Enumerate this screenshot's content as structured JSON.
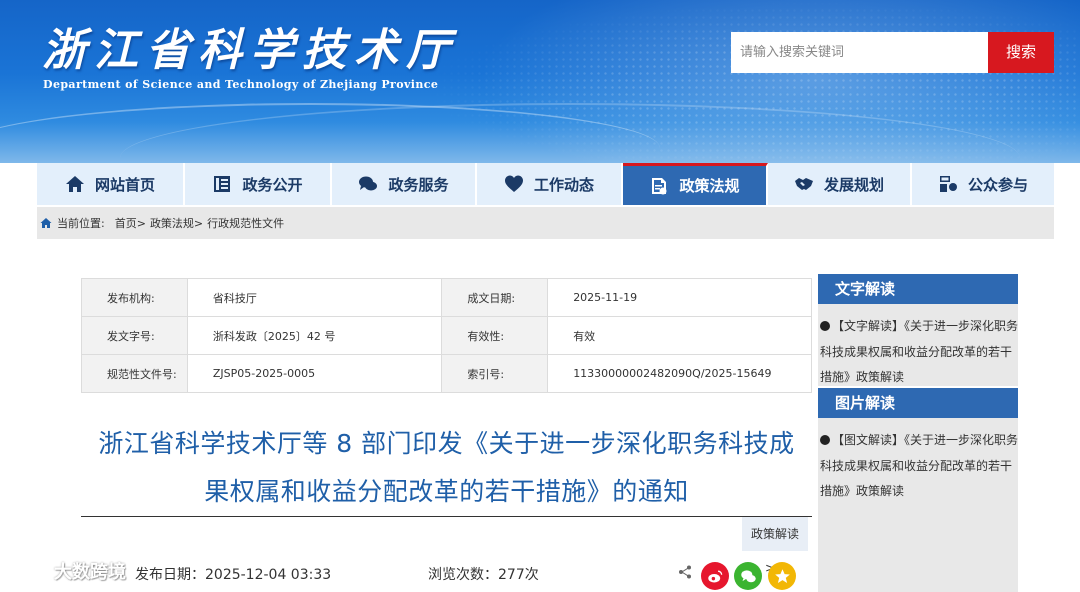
{
  "header": {
    "title": "浙江省科学技术厅",
    "subtitle": "Department of Science and Technology of Zhejiang Province",
    "search_placeholder": "请输入搜索关键词",
    "search_button": "搜索"
  },
  "nav": {
    "items": [
      {
        "label": "网站首页",
        "icon": "home-icon"
      },
      {
        "label": "政务公开",
        "icon": "list-icon"
      },
      {
        "label": "政务服务",
        "icon": "chat-icon"
      },
      {
        "label": "工作动态",
        "icon": "heart-icon"
      },
      {
        "label": "政策法规",
        "icon": "policy-icon",
        "active": true
      },
      {
        "label": "发展规划",
        "icon": "handshake-icon"
      },
      {
        "label": "公众参与",
        "icon": "participate-icon"
      }
    ],
    "active_color": "#2e69b2",
    "accent_color": "#d7181f"
  },
  "breadcrumb": {
    "prefix": "当前位置:",
    "items": [
      "首页>",
      "政策法规>",
      "行政规范性文件"
    ]
  },
  "info_table": {
    "rows": [
      [
        {
          "k": "发布机构:",
          "v": "省科技厅"
        },
        {
          "k": "成文日期:",
          "v": "2025-11-19"
        }
      ],
      [
        {
          "k": "发文字号:",
          "v": "浙科发政〔2025〕42 号"
        },
        {
          "k": "有效性:",
          "v": "有效"
        }
      ],
      [
        {
          "k": "规范性文件号:",
          "v": "ZJSP05-2025-0005"
        },
        {
          "k": "索引号:",
          "v": "11330000002482090Q/2025-15649"
        }
      ]
    ]
  },
  "document": {
    "title_line1": "浙江省科学技术厅等 8 部门印发《关于进一步深化职务科技成",
    "title_line2": "果权属和收益分配改革的若干措施》的通知",
    "policy_link": "政策解读>>",
    "publish_label": "发布日期：",
    "publish_date": "2025-12-04 03:33",
    "views_label": "浏览次数：",
    "views_count": "277次"
  },
  "sidebar": {
    "text_section": {
      "title": "文字解读",
      "item": "【文字解读】《关于进一步深化职务科技成果权属和收益分配改革的若干措施》政策解读"
    },
    "image_section": {
      "title": "图片解读",
      "item": "【图文解读】《关于进一步深化职务科技成果权属和收益分配改革的若干措施》政策解读"
    }
  },
  "watermark": {
    "text": "大数跨境"
  }
}
